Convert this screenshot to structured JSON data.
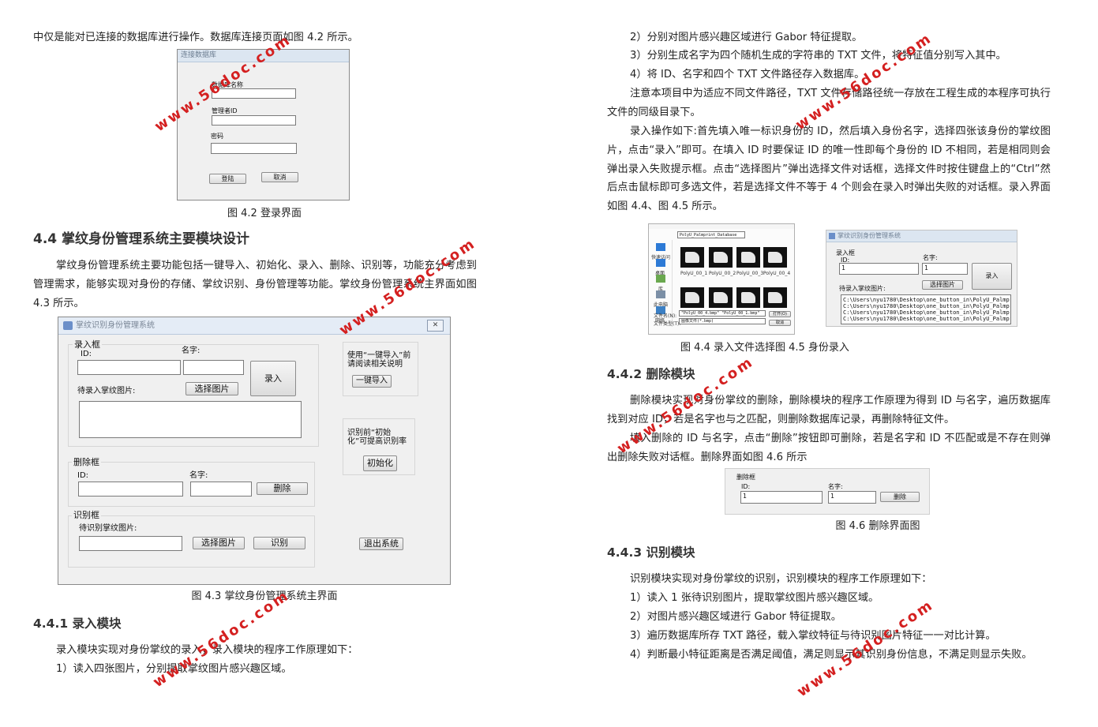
{
  "left": {
    "intro_line": "中仅是能对已连接的数据库进行操作。数据库连接页面如图 4.2 所示。",
    "login_window": {
      "title": "连接数据库",
      "db_name_label": "数据库名称",
      "admin_id_label": "管理者ID",
      "password_label": "密码",
      "login_button": "登陆",
      "cancel_button": "取消"
    },
    "fig42_caption": "图 4.2 登录界面",
    "sec44_heading": "4.4 掌纹身份管理系统主要模块设计",
    "sec44_para": "掌纹身份管理系统主要功能包括一键导入、初始化、录入、删除、识别等，功能充分考虑到管理需求，能够实现对身份的存储、掌纹识别、身份管理等功能。掌纹身份管理系统主界面如图 4.3 所示。",
    "main_window": {
      "title": "掌纹识别身份管理系统",
      "close_glyph": "✕",
      "enroll_group": "录入框",
      "id_label": "ID:",
      "name_label": "名字:",
      "enroll_button": "录入",
      "palm_images_label": "待录入掌纹图片:",
      "select_image_button": "选择图片",
      "import_note": "使用“一键导入”前请阅读相关说明",
      "one_click_import_button": "一键导入",
      "init_note": "识别前“初始化”可提高识别率",
      "init_button": "初始化",
      "delete_group": "删除框",
      "delete_id_label": "ID:",
      "delete_name_label": "名字:",
      "delete_button": "删除",
      "recognize_group": "识别框",
      "recognize_label": "待识别掌纹图片:",
      "recognize_select_button": "选择图片",
      "recognize_button": "识别",
      "exit_button": "退出系统"
    },
    "fig43_caption": "图 4.3 掌纹身份管理系统主界面",
    "sec441_heading": "4.4.1 录入模块",
    "sec441_para": "录入模块实现对身份掌纹的录入，录入模块的程序工作原理如下：",
    "sec441_item1": "1）读入四张图片，分别提取掌纹图片感兴趣区域。"
  },
  "right": {
    "item2": "2）分别对图片感兴趣区域进行 Gabor 特征提取。",
    "item3": "3）分别生成名字为四个随机生成的字符串的 TXT 文件，将特征值分别写入其中。",
    "item4": "4）将 ID、名字和四个 TXT 文件路径存入数据库。",
    "note_para": "注意本项目中为适应不同文件路径，TXT 文件存储路径统一存放在工程生成的本程序可执行文件的同级目录下。",
    "op_para": "录入操作如下:首先填入唯一标识身份的 ID，然后填入身份名字，选择四张该身份的掌纹图片，点击“录入”即可。在填入 ID 时要保证 ID 的唯一性即每个身份的 ID 不相同，若是相同则会弹出录入失败提示框。点击“选择图片”弹出选择文件对话框，选择文件时按住键盘上的“Ctrl”然后点击鼠标即可多选文件，若是选择文件不等于 4 个则会在录入时弹出失败的对话框。录入界面如图 4.4、图 4.5 所示。",
    "file_dialog": {
      "location": "PolyU_Palmprint_Database",
      "thumbs": [
        "PolyU_00_1",
        "PolyU_00_2",
        "PolyU_00_3",
        "PolyU_00_4"
      ],
      "filename_label": "文件名(N):",
      "filetype_label": "文件类型(T):",
      "filename_value": "\"PolyU_00_4.bmp\" \"PolyU_00_1.bmp\"",
      "filetype_value": "图像文件(*.bmp)",
      "open_button": "打开(O)",
      "cancel_button": "取消",
      "sidebar": [
        "快速访问",
        "桌面",
        "库",
        "此电脑",
        "网络"
      ]
    },
    "enroll_window": {
      "title": "掌纹识别身份管理系统",
      "group": "录入框",
      "id_label": "ID:",
      "name_label": "名字:",
      "id_value": "1",
      "name_value": "1",
      "enroll_button": "录入",
      "select_button": "选择图片",
      "palm_label": "待录入掌纹图片:",
      "paths": [
        "C:\\Users\\nyu1780\\Desktop\\one_button_in\\PolyU_Palmprint_Da",
        "C:\\Users\\nyu1780\\Desktop\\one_button_in\\PolyU_Palmprint_Da",
        "C:\\Users\\nyu1780\\Desktop\\one_button_in\\PolyU_Palmprint_Da",
        "C:\\Users\\nyu1780\\Desktop\\one_button_in\\PolyU_Palmprint_Da"
      ]
    },
    "fig4445_caption": "图 4.4 录入文件选择图 4.5 身份录入",
    "sec442_heading": "4.4.2 删除模块",
    "sec442_para1": "删除模块实现对身份掌纹的删除，删除模块的程序工作原理为得到 ID 与名字，遍历数据库找到对应 ID，若是名字也与之匹配，则删除数据库记录，再删除特征文件。",
    "sec442_para2": "填入删除的 ID 与名字，点击“删除”按钮即可删除，若是名字和 ID 不匹配或是不存在则弹出删除失败对话框。删除界面如图 4.6 所示",
    "delete_window": {
      "group": "删除框",
      "id_label": "ID:",
      "name_label": "名字:",
      "id_value": "1",
      "name_value": "1",
      "delete_button": "删除"
    },
    "fig46_caption": "图 4.6 删除界面图",
    "sec443_heading": "4.4.3 识别模块",
    "sec443_para": "识别模块实现对身份掌纹的识别，识别模块的程序工作原理如下：",
    "sec443_item1": "1）读入 1 张待识别图片，提取掌纹图片感兴趣区域。",
    "sec443_item2": "2）对图片感兴趣区域进行 Gabor 特征提取。",
    "sec443_item3": "3）遍历数据库所存 TXT 路径，载入掌纹特征与待识别图片特征一一对比计算。",
    "sec443_item4": "4）判断最小特征距离是否满足阈值，满足则显示其识别身份信息，不满足则显示失败。"
  },
  "watermark": "www.56doc.com",
  "colors": {
    "watermark": "#d42020",
    "titlebar": "#dce6f1",
    "window_bg": "#f0f0f0"
  }
}
